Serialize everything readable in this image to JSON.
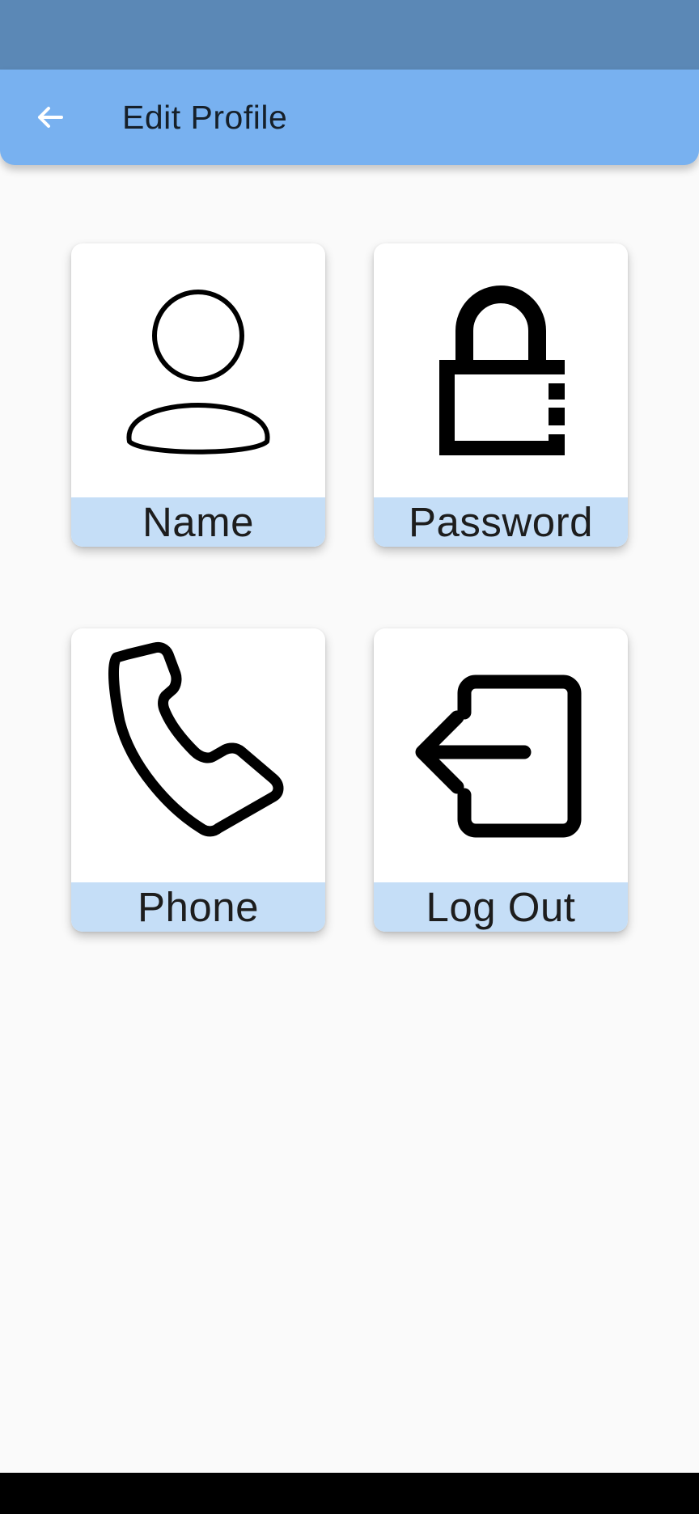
{
  "header": {
    "title": "Edit Profile",
    "back_icon": "arrow-left-icon"
  },
  "tiles": [
    {
      "label": "Name",
      "icon": "person-icon"
    },
    {
      "label": "Password",
      "icon": "lock-icon"
    },
    {
      "label": "Phone",
      "icon": "phone-icon"
    },
    {
      "label": "Log Out",
      "icon": "logout-icon"
    }
  ],
  "colors": {
    "status_bar": "#5b88b6",
    "app_bar": "#78b1f0",
    "tile_label_bg": "#c5def7",
    "background": "#fafafa",
    "nav_bar": "#000000"
  }
}
